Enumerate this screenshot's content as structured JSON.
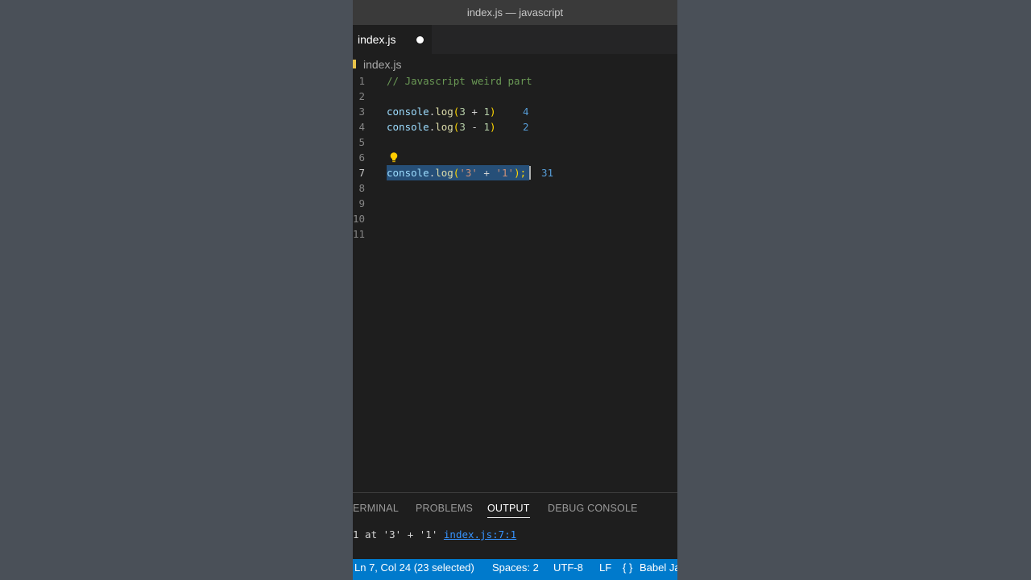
{
  "window": {
    "title": "index.js — javascript"
  },
  "tab": {
    "label": "index.js",
    "dirty_indicator": "●"
  },
  "breadcrumb": {
    "file": "index.js",
    "icon": "js-file-icon",
    "icon_color": "#e8c34a"
  },
  "editor": {
    "line_numbers": [
      "1",
      "2",
      "3",
      "4",
      "5",
      "6",
      "7",
      "8",
      "9",
      "10",
      "11"
    ],
    "active_line": "7",
    "lines": {
      "l1": {
        "comment": "// Javascript weird part"
      },
      "l3": {
        "obj": "console",
        "dot": ".",
        "fn": "log",
        "open": "(",
        "a": "3",
        "op": " + ",
        "b": "1",
        "close": ")",
        "result": "4"
      },
      "l4": {
        "obj": "console",
        "dot": ".",
        "fn": "log",
        "open": "(",
        "a": "3",
        "op": " - ",
        "b": "1",
        "close": ")",
        "result": "2"
      },
      "l7": {
        "obj": "console",
        "dot": ".",
        "fn": "log",
        "open": "(",
        "a": "'3'",
        "op": " + ",
        "b": "'1'",
        "close": ");",
        "result": "31"
      }
    },
    "lightbulb_icon": "lightbulb-icon"
  },
  "panel": {
    "tabs": [
      {
        "label": "ERMINAL"
      },
      {
        "label": "PROBLEMS"
      },
      {
        "label": "OUTPUT",
        "active": true
      },
      {
        "label": "DEBUG CONSOLE"
      }
    ],
    "output": {
      "text": "1 at '3' + '1' ",
      "link": "index.js:7:1"
    }
  },
  "statusbar": {
    "position": "Ln 7, Col 24 (23 selected)",
    "spaces": "Spaces: 2",
    "encoding": "UTF-8",
    "eol": "LF",
    "language_icon": "{ }",
    "language": "Babel Ja"
  },
  "colors": {
    "background": "#4a5058",
    "editor_bg": "#1e1e1e",
    "statusbar": "#007acc",
    "selection": "#264f78"
  }
}
